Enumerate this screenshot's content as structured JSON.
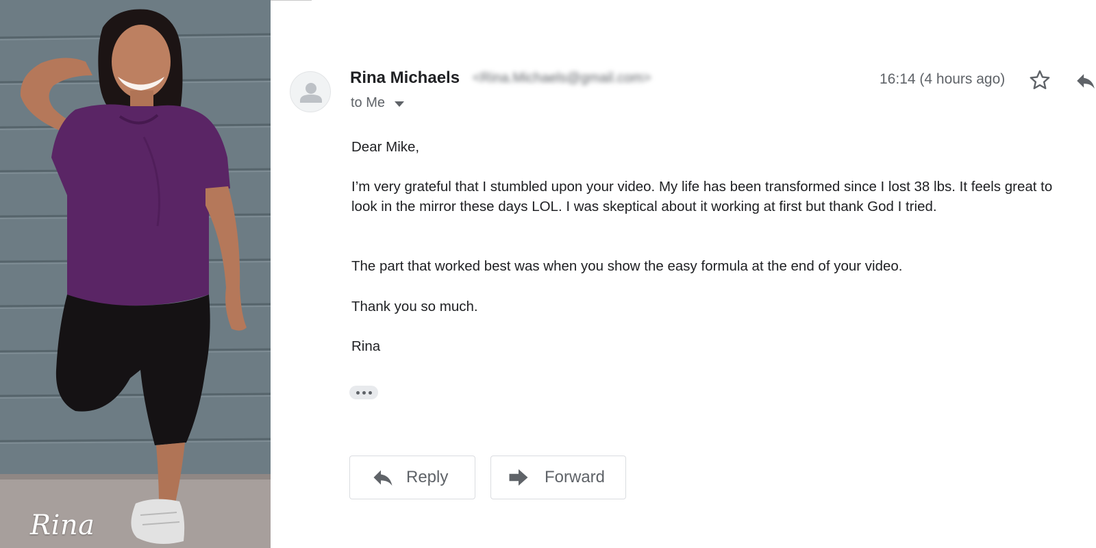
{
  "photo": {
    "caption": "Rina"
  },
  "email": {
    "sender_name": "Rina Michaels",
    "sender_email": "<Rina.Michaels@gmail.com>",
    "recipient_label": "to Me",
    "timestamp": "16:14 (4 hours ago)",
    "greeting": "Dear Mike,",
    "paragraphs": [
      "I’m very grateful that I stumbled upon your video. My life has been transformed since I lost 38 lbs. It feels great to look in the mirror these days LOL. I was skeptical about it working at first but thank God I tried.",
      "The part that worked best was when you show the easy formula at the end of your video.",
      "Thank you so much."
    ],
    "signoff": "Rina"
  },
  "actions": {
    "reply_label": "Reply",
    "forward_label": "Forward"
  },
  "icons": {
    "avatar": "person-avatar-icon",
    "star": "star-icon",
    "reply": "reply-arrow-icon",
    "forward": "forward-arrow-icon",
    "caret": "caret-down-icon",
    "more": "ellipsis-icon"
  },
  "colors": {
    "text_primary": "#202124",
    "text_secondary": "#5f6368",
    "button_border": "#dadce0",
    "shirt_purple": "#5a2565"
  }
}
